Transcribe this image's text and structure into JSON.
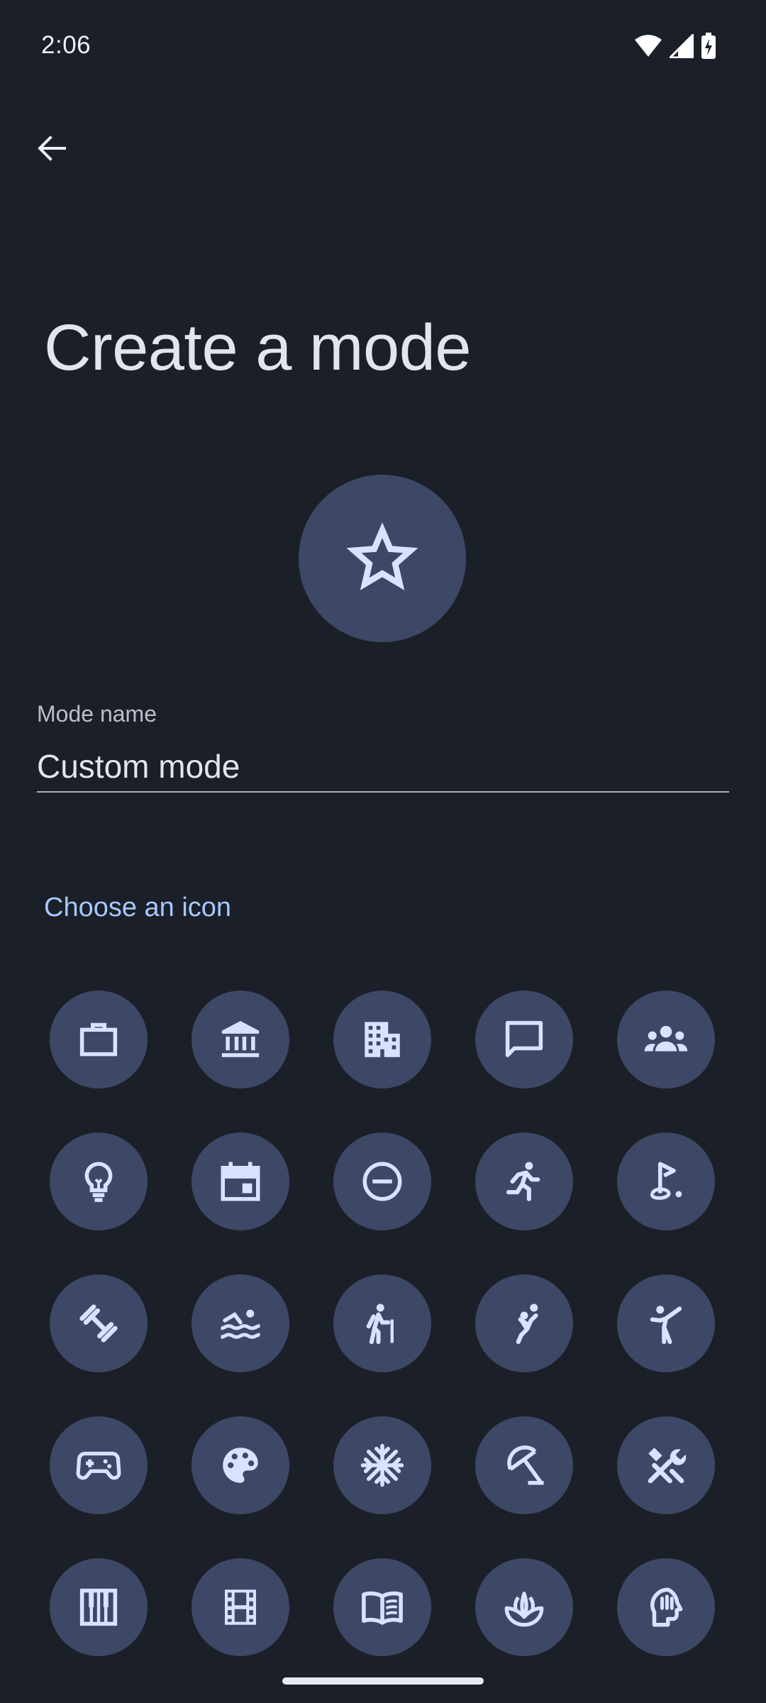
{
  "status_bar": {
    "time": "2:06",
    "icons": [
      "wifi-icon",
      "cellular-signal-icon",
      "battery-charging-icon"
    ]
  },
  "toolbar": {
    "back_icon": "arrow-back-icon"
  },
  "page": {
    "title": "Create a mode"
  },
  "selected_icon": {
    "name": "star-icon"
  },
  "mode_name_field": {
    "label": "Mode name",
    "value": "Custom mode"
  },
  "icon_section": {
    "title": "Choose an icon",
    "icons": [
      "briefcase-icon",
      "bank-icon",
      "apartment-icon",
      "chat-bubble-icon",
      "groups-icon",
      "lightbulb-icon",
      "calendar-event-icon",
      "do-not-disturb-icon",
      "running-icon",
      "golf-icon",
      "fitness-icon",
      "swimming-icon",
      "hiking-icon",
      "handball-icon",
      "martial-arts-icon",
      "gamepad-icon",
      "palette-icon",
      "snowflake-icon",
      "beach-umbrella-icon",
      "tools-icon",
      "piano-icon",
      "film-icon",
      "book-icon",
      "spa-icon",
      "psychology-icon"
    ]
  },
  "colors": {
    "background": "#1b1f27",
    "icon_circle": "#3d4866",
    "icon_glyph": "#d9e2ff",
    "accent": "#a5c8ff",
    "text_primary": "#e2e5ee",
    "text_secondary": "#b9bfcd"
  }
}
